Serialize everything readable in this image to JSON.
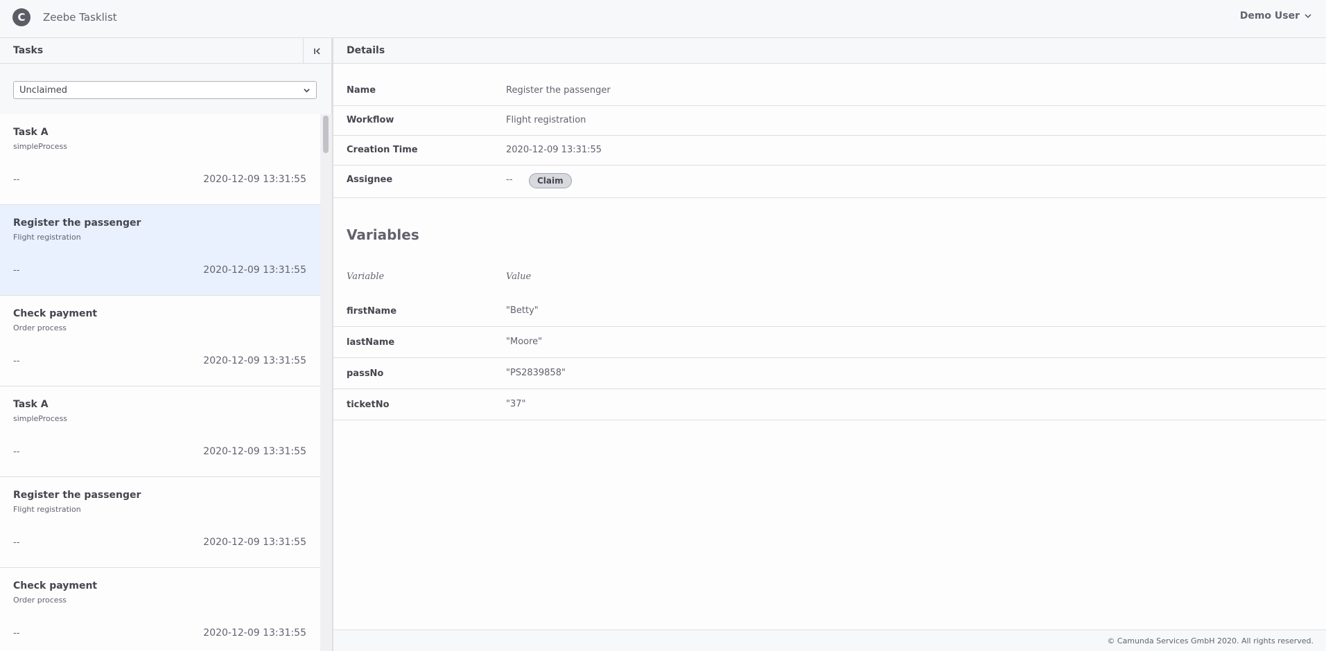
{
  "header": {
    "logo_letter": "C",
    "title": "Zeebe Tasklist",
    "user": "Demo User"
  },
  "tasks_panel": {
    "title": "Tasks",
    "filter": "Unclaimed",
    "items": [
      {
        "name": "Task A",
        "process": "simpleProcess",
        "assignee": "--",
        "time": "2020-12-09 13:31:55",
        "selected": false
      },
      {
        "name": "Register the passenger",
        "process": "Flight registration",
        "assignee": "--",
        "time": "2020-12-09 13:31:55",
        "selected": true
      },
      {
        "name": "Check payment",
        "process": "Order process",
        "assignee": "--",
        "time": "2020-12-09 13:31:55",
        "selected": false
      },
      {
        "name": "Task A",
        "process": "simpleProcess",
        "assignee": "--",
        "time": "2020-12-09 13:31:55",
        "selected": false
      },
      {
        "name": "Register the passenger",
        "process": "Flight registration",
        "assignee": "--",
        "time": "2020-12-09 13:31:55",
        "selected": false
      },
      {
        "name": "Check payment",
        "process": "Order process",
        "assignee": "--",
        "time": "2020-12-09 13:31:55",
        "selected": false
      }
    ]
  },
  "details_panel": {
    "title": "Details",
    "name_label": "Name",
    "name_value": "Register the passenger",
    "workflow_label": "Workflow",
    "workflow_value": "Flight registration",
    "creation_label": "Creation Time",
    "creation_value": "2020-12-09 13:31:55",
    "assignee_label": "Assignee",
    "assignee_value": "--",
    "claim_label": "Claim"
  },
  "variables": {
    "title": "Variables",
    "col_variable": "Variable",
    "col_value": "Value",
    "rows": [
      {
        "name": "firstName",
        "value": "\"Betty\""
      },
      {
        "name": "lastName",
        "value": "\"Moore\""
      },
      {
        "name": "passNo",
        "value": "\"PS2839858\""
      },
      {
        "name": "ticketNo",
        "value": "\"37\""
      }
    ]
  },
  "footer": {
    "text": "© Camunda Services GmbH 2020. All rights reserved."
  }
}
